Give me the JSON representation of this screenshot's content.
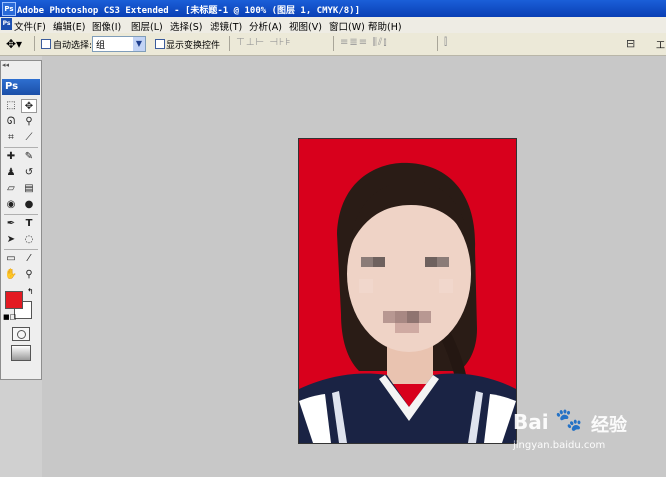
{
  "window": {
    "title": "Adobe Photoshop CS3 Extended - [未标题-1 @ 100% (图层 1, CMYK/8)]",
    "app_icon_label": "Ps"
  },
  "menubar": {
    "items": [
      "文件(F)",
      "编辑(E)",
      "图像(I)",
      "图层(L)",
      "选择(S)",
      "滤镜(T)",
      "分析(A)",
      "视图(V)",
      "窗口(W)",
      "帮助(H)"
    ]
  },
  "options_bar": {
    "auto_select_label": "自动选择:",
    "auto_select_value": "组",
    "show_transform_label": "显示变换控件",
    "align_group_1": "⊤⊥⊢ ⊣⊦⊧",
    "align_group_2": "≡≣≡ ⫼⫽⫾",
    "align_group_3": "⫿",
    "workspace_label": "工"
  },
  "toolbox": {
    "logo": "Ps",
    "collapse": "◂◂",
    "foreground_color": "#e31a22",
    "background_color": "#ffffff",
    "tools": [
      {
        "name": "marquee-tool-icon",
        "glyph": "⬚"
      },
      {
        "name": "move-tool-icon",
        "glyph": "✥"
      },
      {
        "name": "lasso-tool-icon",
        "glyph": "ᘏ"
      },
      {
        "name": "magic-wand-tool-icon",
        "glyph": "⚲"
      },
      {
        "name": "crop-tool-icon",
        "glyph": "⌗"
      },
      {
        "name": "slice-tool-icon",
        "glyph": "⟋"
      },
      {
        "name": "healing-brush-tool-icon",
        "glyph": "✚"
      },
      {
        "name": "brush-tool-icon",
        "glyph": "✎"
      },
      {
        "name": "clone-stamp-tool-icon",
        "glyph": "♟"
      },
      {
        "name": "history-brush-tool-icon",
        "glyph": "↺"
      },
      {
        "name": "eraser-tool-icon",
        "glyph": "▱"
      },
      {
        "name": "gradient-tool-icon",
        "glyph": "▤"
      },
      {
        "name": "blur-tool-icon",
        "glyph": "◉"
      },
      {
        "name": "dodge-tool-icon",
        "glyph": "●"
      },
      {
        "name": "pen-tool-icon",
        "glyph": "✒"
      },
      {
        "name": "type-tool-icon",
        "glyph": "T"
      },
      {
        "name": "path-selection-tool-icon",
        "glyph": "➤"
      },
      {
        "name": "shape-tool-icon",
        "glyph": "◌"
      },
      {
        "name": "notes-tool-icon",
        "glyph": "▭"
      },
      {
        "name": "eyedropper-tool-icon",
        "glyph": "⁄"
      },
      {
        "name": "hand-tool-icon",
        "glyph": "✋"
      },
      {
        "name": "zoom-tool-icon",
        "glyph": "⚲"
      }
    ]
  },
  "watermark": {
    "brand_text": "Bai",
    "brand_text_2": "经验",
    "url": "jingyan.baidu.com"
  }
}
